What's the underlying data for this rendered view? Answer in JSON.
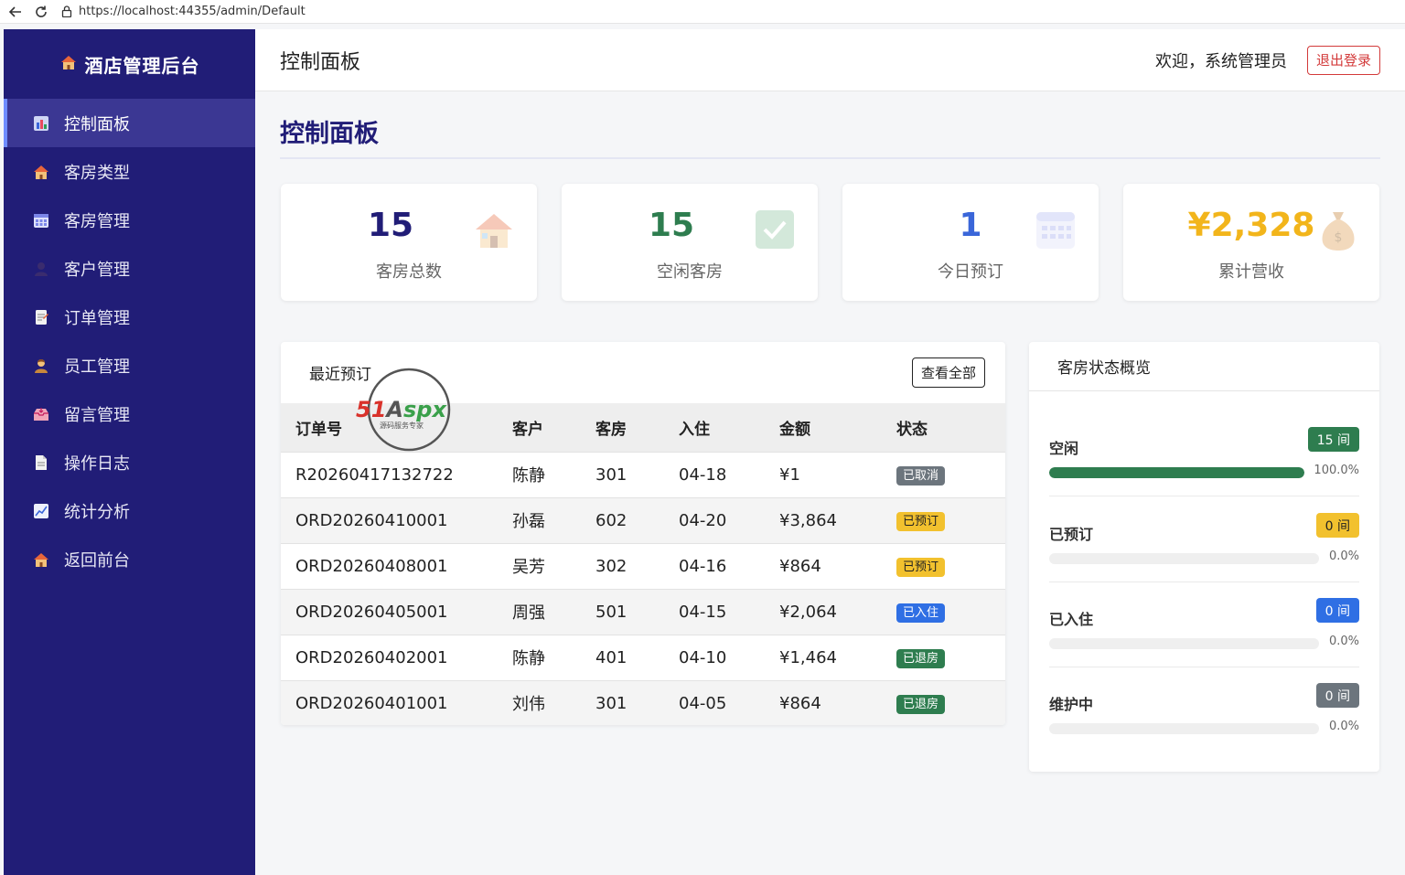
{
  "browser": {
    "url": "https://localhost:44355/admin/Default"
  },
  "sidebar": {
    "brand": "酒店管理后台",
    "items": [
      {
        "label": "控制面板",
        "icon": "bar-chart-icon",
        "active": true
      },
      {
        "label": "客房类型",
        "icon": "house-icon"
      },
      {
        "label": "客房管理",
        "icon": "calendar-grid-icon"
      },
      {
        "label": "客户管理",
        "icon": "person-icon"
      },
      {
        "label": "订单管理",
        "icon": "memo-icon"
      },
      {
        "label": "员工管理",
        "icon": "employee-icon"
      },
      {
        "label": "留言管理",
        "icon": "inbox-icon"
      },
      {
        "label": "操作日志",
        "icon": "document-icon"
      },
      {
        "label": "统计分析",
        "icon": "line-chart-icon"
      },
      {
        "label": "返回前台",
        "icon": "house-icon"
      }
    ]
  },
  "header": {
    "title": "控制面板",
    "welcome": "欢迎，系统管理员",
    "logout_label": "退出登录"
  },
  "main": {
    "heading": "控制面板",
    "stats": [
      {
        "value": "15",
        "label": "客房总数",
        "color": "#211d77",
        "icon": "house-icon"
      },
      {
        "value": "15",
        "label": "空闲客房",
        "color": "#2e7d4f",
        "icon": "check-box-icon"
      },
      {
        "value": "1",
        "label": "今日预订",
        "color": "#3a66d9",
        "icon": "calendar-icon"
      },
      {
        "value": "¥2,328",
        "label": "累计营收",
        "color": "#f2b51b",
        "icon": "money-bag-icon"
      }
    ],
    "recent": {
      "title": "最近预订",
      "view_all_label": "查看全部",
      "columns": [
        "订单号",
        "客户",
        "客房",
        "入住",
        "金额",
        "状态"
      ],
      "rows": [
        {
          "order_no": "R20260417132722",
          "customer": "陈静",
          "room": "301",
          "checkin": "04-18",
          "amount": "¥1",
          "status": "已取消",
          "status_color": "#6c757d",
          "status_text_color": "#ffffff"
        },
        {
          "order_no": "ORD20260410001",
          "customer": "孙磊",
          "room": "602",
          "checkin": "04-20",
          "amount": "¥3,864",
          "status": "已预订",
          "status_color": "#f2c12e",
          "status_text_color": "#222222"
        },
        {
          "order_no": "ORD20260408001",
          "customer": "吴芳",
          "room": "302",
          "checkin": "04-16",
          "amount": "¥864",
          "status": "已预订",
          "status_color": "#f2c12e",
          "status_text_color": "#222222"
        },
        {
          "order_no": "ORD20260405001",
          "customer": "周强",
          "room": "501",
          "checkin": "04-15",
          "amount": "¥2,064",
          "status": "已入住",
          "status_color": "#2f6fe4",
          "status_text_color": "#ffffff"
        },
        {
          "order_no": "ORD20260402001",
          "customer": "陈静",
          "room": "401",
          "checkin": "04-10",
          "amount": "¥1,464",
          "status": "已退房",
          "status_color": "#2e7d4f",
          "status_text_color": "#ffffff"
        },
        {
          "order_no": "ORD20260401001",
          "customer": "刘伟",
          "room": "301",
          "checkin": "04-05",
          "amount": "¥864",
          "status": "已退房",
          "status_color": "#2e7d4f",
          "status_text_color": "#ffffff"
        }
      ]
    },
    "room_status": {
      "title": "客房状态概览",
      "items": [
        {
          "label": "空闲",
          "count": "15 间",
          "percent_text": "100.0%",
          "percent": 100,
          "color": "#2e7d4f",
          "text_color": "#ffffff"
        },
        {
          "label": "已预订",
          "count": "0 间",
          "percent_text": "0.0%",
          "percent": 0,
          "color": "#f2c12e",
          "text_color": "#222222"
        },
        {
          "label": "已入住",
          "count": "0 间",
          "percent_text": "0.0%",
          "percent": 0,
          "color": "#2f6fe4",
          "text_color": "#ffffff"
        },
        {
          "label": "维护中",
          "count": "0 间",
          "percent_text": "0.0%",
          "percent": 0,
          "color": "#6c757d",
          "text_color": "#ffffff"
        }
      ]
    },
    "watermark": {
      "logo_text": "51Aspx",
      "tagline": "源码服务专家"
    }
  }
}
